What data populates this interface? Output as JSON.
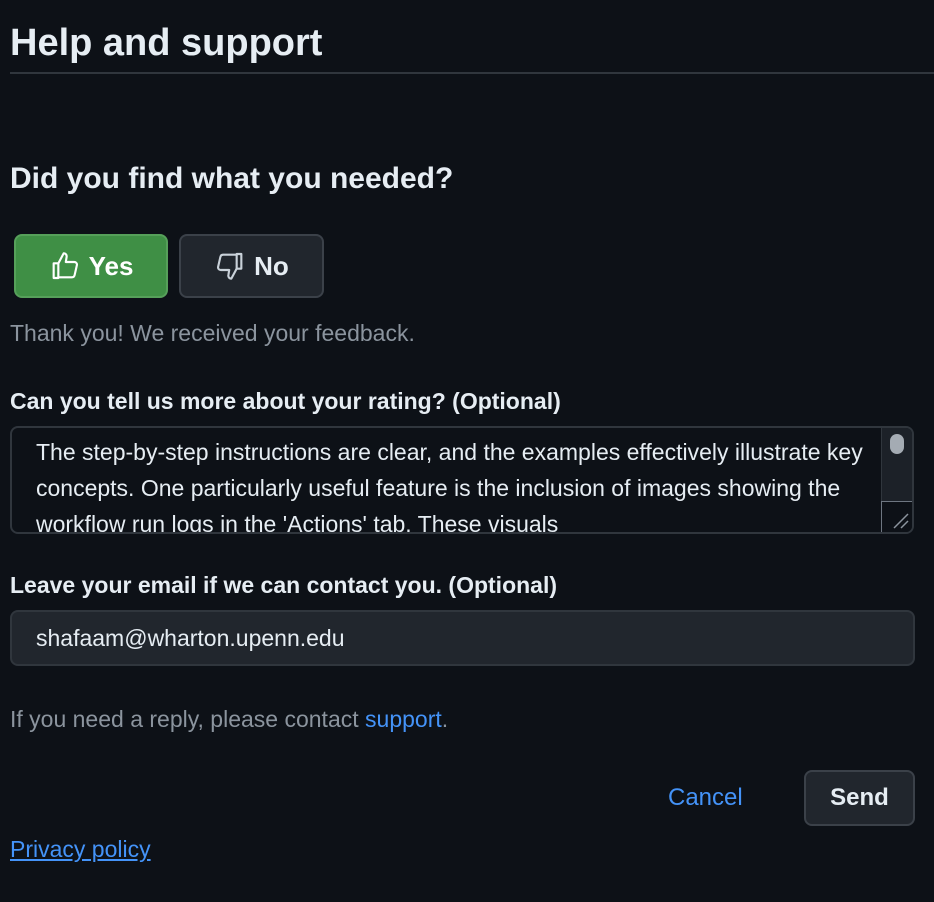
{
  "header": {
    "title": "Help and support"
  },
  "feedback": {
    "question": "Did you find what you needed?",
    "yes_label": "Yes",
    "no_label": "No",
    "selected": "Yes",
    "yes_icon": "thumbs-up-icon",
    "no_icon": "thumbs-down-icon",
    "thank_you": "Thank you! We received your feedback."
  },
  "rating_details": {
    "label": "Can you tell us more about your rating? (Optional)",
    "value": "The step-by-step instructions are clear, and the examples effectively illustrate key concepts. One particularly useful feature is the inclusion of images showing the workflow run logs in the 'Actions' tab. These visuals"
  },
  "email": {
    "label": "Leave your email if we can contact you. (Optional)",
    "value": "shafaam@wharton.upenn.edu"
  },
  "reply_note": {
    "prefix": "If you need a reply, please contact ",
    "link_text": "support",
    "suffix": "."
  },
  "actions": {
    "cancel_label": "Cancel",
    "send_label": "Send"
  },
  "footer": {
    "privacy_label": "Privacy policy"
  },
  "colors": {
    "background": "#0d1117",
    "yes_button": "#3f8f45",
    "link": "#4493f8",
    "muted_text": "#8b949e"
  }
}
